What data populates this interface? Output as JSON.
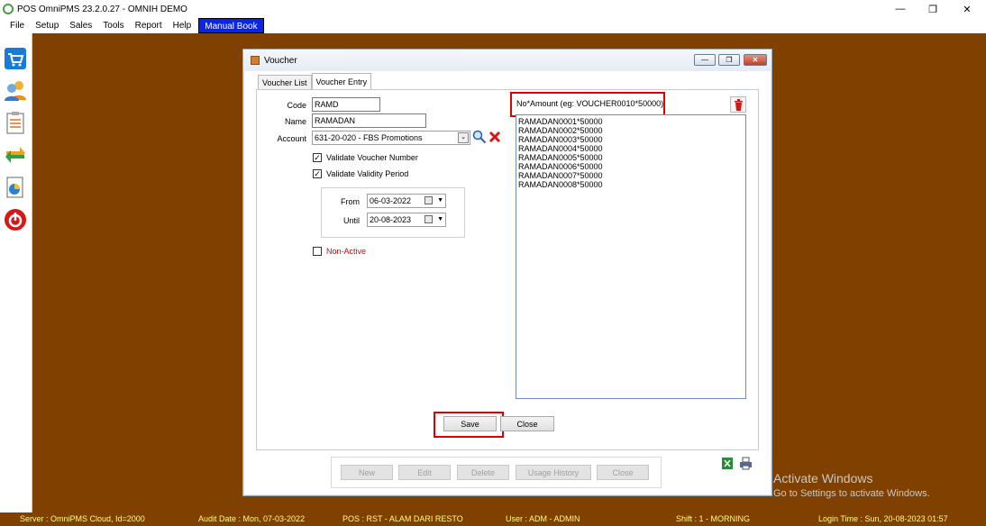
{
  "window": {
    "title": "POS OmniPMS 23.2.0.27 - OMNIH DEMO",
    "minimize": "—",
    "restore": "❐",
    "close": "✕"
  },
  "menu": {
    "items": [
      "File",
      "Setup",
      "Sales",
      "Tools",
      "Report",
      "Help"
    ],
    "manual_book": "Manual Book"
  },
  "toolbar": {
    "icons": [
      "cart-icon",
      "users-icon",
      "checklist-icon",
      "transfer-icon",
      "report-icon",
      "power-icon"
    ]
  },
  "dialog": {
    "title": "Voucher",
    "tabs": [
      "Voucher List",
      "Voucher Entry"
    ],
    "selected_tab": "Voucher Entry",
    "form": {
      "code_label": "Code",
      "code_value": "RAMD",
      "name_label": "Name",
      "name_value": "RAMADAN",
      "account_label": "Account",
      "account_value": "631-20-020 - FBS Promotions",
      "validate_number_label": "Validate Voucher Number",
      "validate_number_checked": true,
      "validate_period_label": "Validate Validity Period",
      "validate_period_checked": true,
      "from_label": "From",
      "from_value": "06-03-2022",
      "until_label": "Until",
      "until_value": "20-08-2023",
      "non_active_label": "Non-Active",
      "non_active_checked": false
    },
    "voucher_list_hint": "No*Amount (eg: VOUCHER0010*50000)",
    "vouchers": [
      "RAMADAN0001*50000",
      "RAMADAN0002*50000",
      "RAMADAN0003*50000",
      "RAMADAN0004*50000",
      "RAMADAN0005*50000",
      "RAMADAN0006*50000",
      "RAMADAN0007*50000",
      "RAMADAN0008*50000"
    ],
    "save_label": "Save",
    "close_label": "Close",
    "bottom_buttons": [
      "New",
      "Edit",
      "Delete",
      "Usage History",
      "Close"
    ]
  },
  "status": {
    "server": "Server : OmniPMS Cloud, Id=2000",
    "audit_date": "Audit Date : Mon, 07-03-2022",
    "pos": "POS : RST - ALAM DARI RESTO",
    "user": "User : ADM - ADMIN",
    "shift": "Shift : 1 - MORNING",
    "login_time": "Login Time : Sun, 20-08-2023 01:57"
  },
  "watermark": {
    "line1": "Activate Windows",
    "line2": "Go to Settings to activate Windows."
  },
  "colors": {
    "workspace": "#804000",
    "status_text": "#ffff80",
    "highlight": "#e00000",
    "manual_book_bg": "#0a24e8"
  }
}
